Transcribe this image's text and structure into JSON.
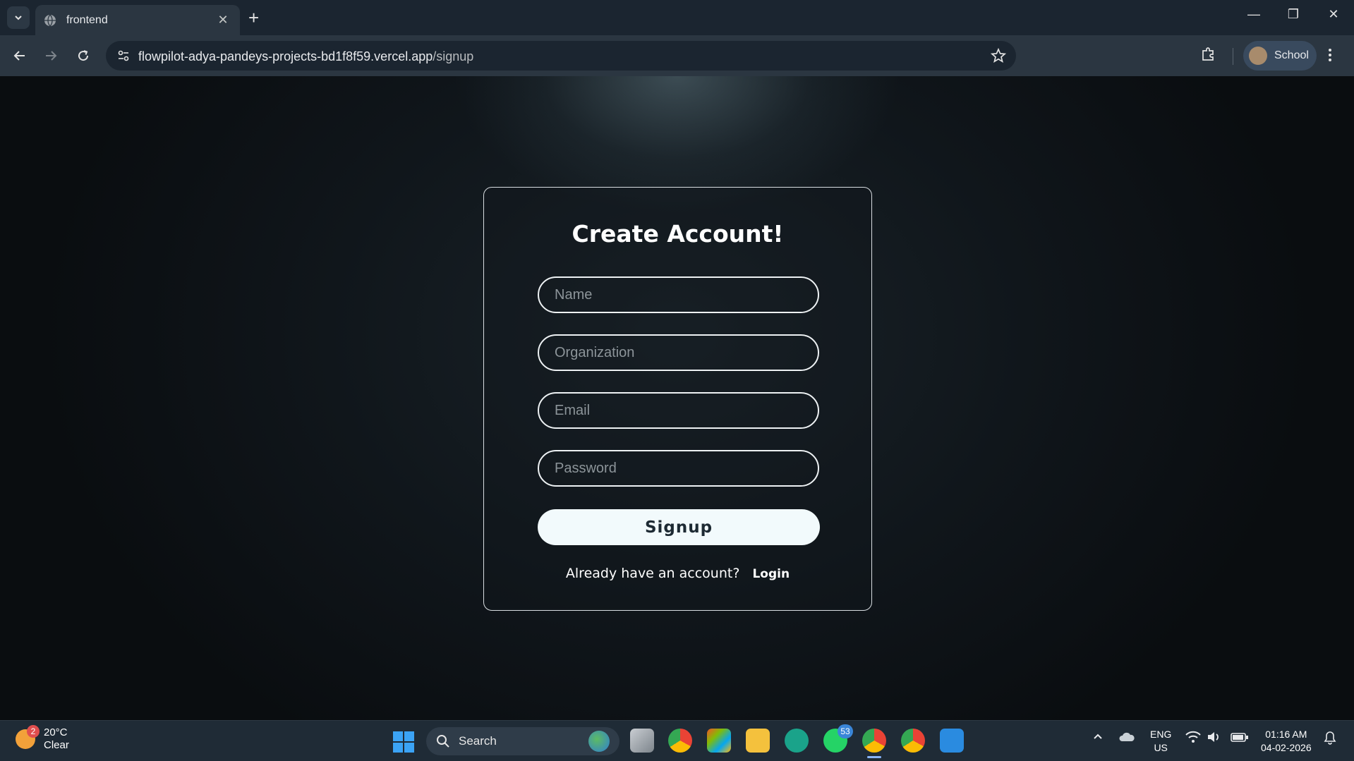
{
  "browser": {
    "tab_title": "frontend",
    "url_domain": "flowpilot-adya-pandeys-projects-bd1f8f59.vercel.app",
    "url_path": "/signup",
    "profile_label": "School"
  },
  "form": {
    "title": "Create Account!",
    "name_placeholder": "Name",
    "organization_placeholder": "Organization",
    "email_placeholder": "Email",
    "password_placeholder": "Password",
    "signup_label": "Signup",
    "login_prompt": "Already have an account?",
    "login_link": "Login"
  },
  "taskbar": {
    "weather_temp": "20°C",
    "weather_desc": "Clear",
    "weather_badge": "2",
    "search_label": "Search",
    "whatsapp_badge": "53",
    "lang_line1": "ENG",
    "lang_line2": "US",
    "time": "01:16 AM",
    "date": "04-02-2026"
  },
  "colors": {
    "page_bg": "#0b0f12",
    "card_border": "#d9dee2",
    "button_bg": "#f2fafc",
    "chrome_bg": "#1b2530",
    "toolbar_bg": "#2b3641"
  }
}
